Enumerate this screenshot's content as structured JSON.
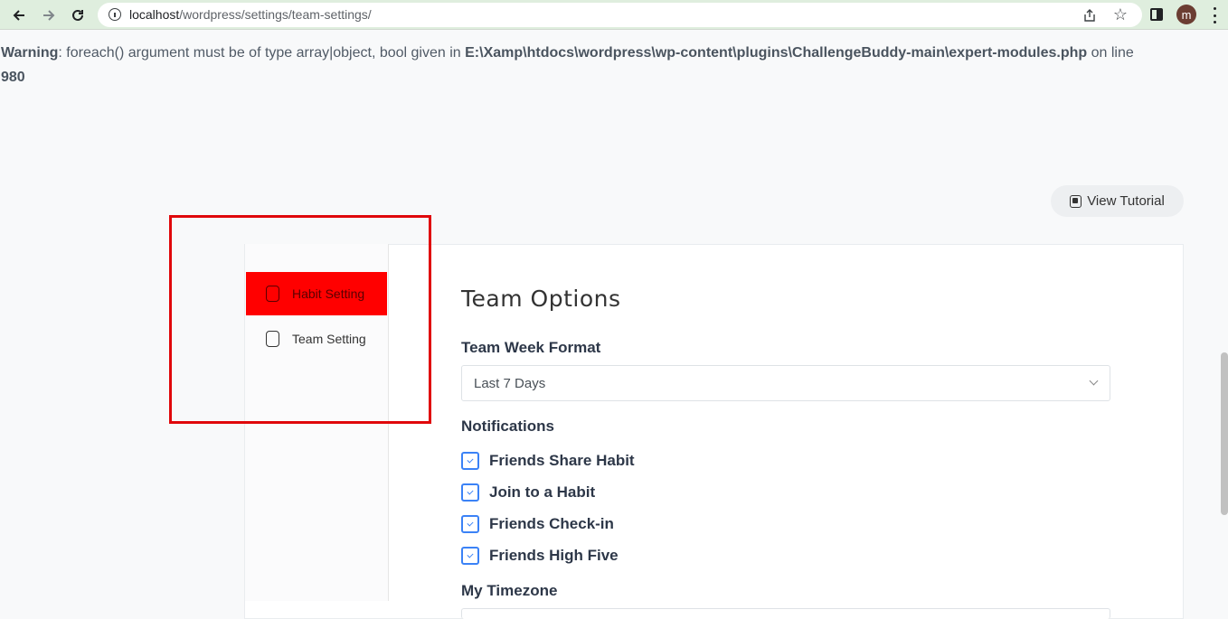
{
  "browser": {
    "url_host": "localhost",
    "url_path": "/wordpress/settings/team-settings/",
    "avatar_letter": "m"
  },
  "warning": {
    "label": "Warning",
    "text_1": ": foreach() argument must be of type array|object, bool given in ",
    "file": "E:\\Xamp\\htdocs\\wordpress\\wp-content\\plugins\\ChallengeBuddy-main\\expert-modules.php",
    "text_2": " on line ",
    "line": "980"
  },
  "tutorial": {
    "label": "View Tutorial"
  },
  "sidebar": {
    "items": [
      {
        "label": "Habit Setting",
        "active": true
      },
      {
        "label": "Team Setting",
        "active": false
      }
    ]
  },
  "main": {
    "title": "Team Options",
    "week_format": {
      "label": "Team Week Format",
      "value": "Last 7 Days"
    },
    "notifications": {
      "label": "Notifications",
      "items": [
        {
          "label": "Friends Share Habit",
          "checked": true
        },
        {
          "label": "Join to a Habit",
          "checked": true
        },
        {
          "label": "Friends Check-in",
          "checked": true
        },
        {
          "label": "Friends High Five",
          "checked": true
        }
      ]
    },
    "timezone": {
      "label": "My Timezone"
    }
  },
  "colors": {
    "active_item": "#ff0000",
    "highlight_border": "#e0080b",
    "checkbox": "#3b82f6",
    "chrome": "#dfeede"
  }
}
